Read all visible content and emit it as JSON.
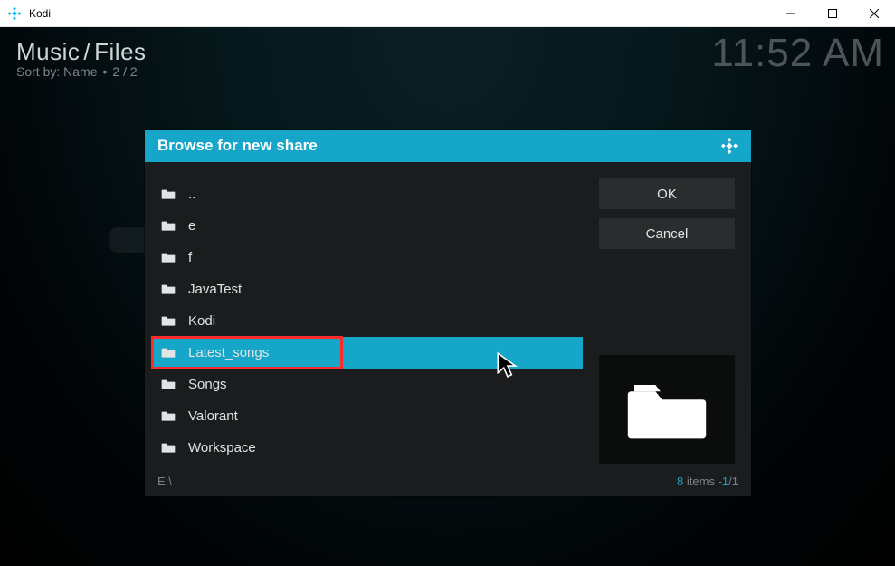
{
  "window": {
    "app_name": "Kodi"
  },
  "breadcrumb": {
    "part1": "Music",
    "part2": "Files",
    "sort_label": "Sort by: Name",
    "page": "2 / 2"
  },
  "clock": "11:52 AM",
  "dialog": {
    "title": "Browse for new share",
    "ok_label": "OK",
    "cancel_label": "Cancel",
    "path": "E:\\",
    "item_count": "8",
    "item_label": " items - ",
    "page_current": "1",
    "page_sep": "/",
    "page_total": "1",
    "items": [
      {
        "label": ".."
      },
      {
        "label": "e"
      },
      {
        "label": "f"
      },
      {
        "label": "JavaTest"
      },
      {
        "label": "Kodi"
      },
      {
        "label": "Latest_songs"
      },
      {
        "label": "Songs"
      },
      {
        "label": "Valorant"
      },
      {
        "label": "Workspace"
      }
    ],
    "selected_index": 5
  }
}
